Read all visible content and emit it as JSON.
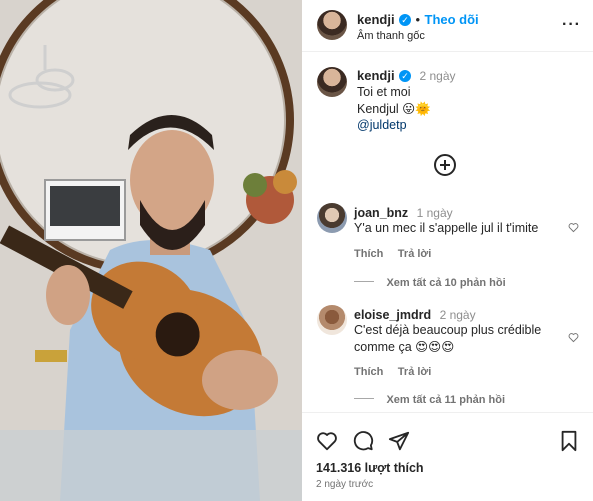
{
  "post": {
    "username": "kendji",
    "follow_label": "Theo dõi",
    "audio_label": "Âm thanh gốc",
    "more_label": "···"
  },
  "caption": {
    "username": "kendji",
    "time": "2 ngày",
    "lines": [
      "Toi et moi",
      "Kendjul 😛🌞"
    ],
    "mention": "@juldetp"
  },
  "comments": [
    {
      "username": "joan_bnz",
      "time": "1 ngày",
      "text_line1": "Y'a un mec il s'appelle jul il t'imite",
      "text_line2": "",
      "reply_label": "Thích",
      "reply_action": "Trả lời",
      "view_replies": "Xem tất cả 10 phản hồi"
    },
    {
      "username": "eloise_jmdrd",
      "time": "2 ngày",
      "text_line1": "C'est déjà beaucoup plus crédible",
      "text_line2": "comme ça 😍😍😍",
      "reply_label": "Thích",
      "reply_action": "Trả lời",
      "view_replies": "Xem tất cả 11 phản hồi"
    }
  ],
  "footer": {
    "likes": "141.316 lượt thích",
    "time_ago": "2 ngày trước"
  },
  "icons": [
    "heart-icon",
    "comment-icon",
    "share-icon",
    "bookmark-icon",
    "add-comment-icon",
    "more-icon",
    "verified-icon"
  ]
}
